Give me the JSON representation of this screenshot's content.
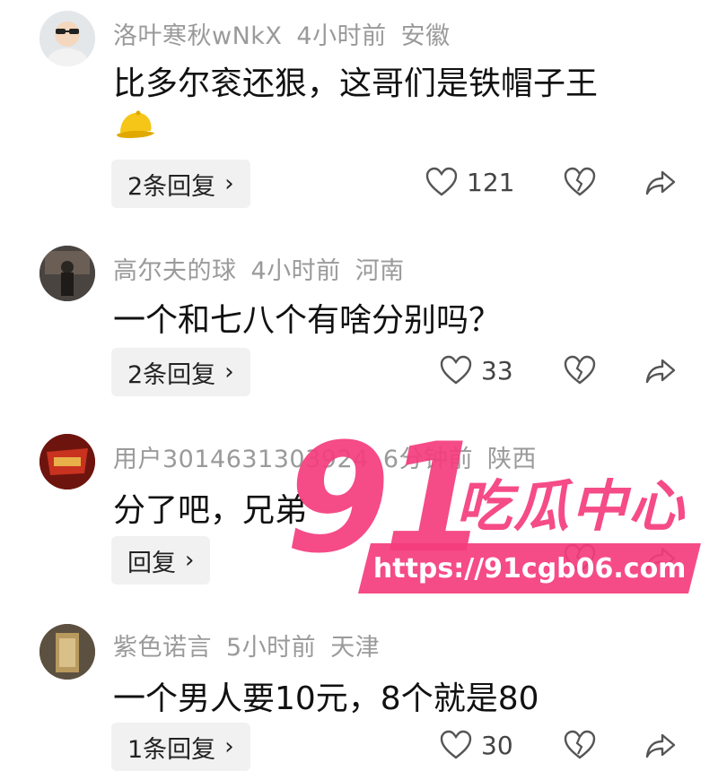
{
  "comments": [
    {
      "username": "洛叶寒秋wNkX",
      "time": "4小时前",
      "location": "安徽",
      "text": "比多尔衮还狠，这哥们是铁帽子王",
      "emoji": "yellow-cap",
      "reply_label": "2条回复",
      "likes": "121"
    },
    {
      "username": "高尔夫的球",
      "time": "4小时前",
      "location": "河南",
      "text": "一个和七八个有啥分别吗？",
      "reply_label": "2条回复",
      "likes": "33"
    },
    {
      "username": "用户3014631303924",
      "time": "6分钟前",
      "location": "陕西",
      "text": "分了吧，兄弟",
      "reply_label": "回复"
    },
    {
      "username": "紫色诺言",
      "time": "5小时前",
      "location": "天津",
      "text": "一个男人要10元，8个就是80",
      "reply_label": "1条回复",
      "likes": "30"
    }
  ],
  "reply_chevron": "›",
  "watermark": {
    "number": "91",
    "text": "吃瓜中心",
    "url": "https://91cgb06.com",
    "color": "#f43c7d"
  },
  "colors": {
    "meta_gray": "#9a9a9a",
    "reply_bg": "#f1f1f1",
    "cap_yellow": "#f5c518"
  }
}
